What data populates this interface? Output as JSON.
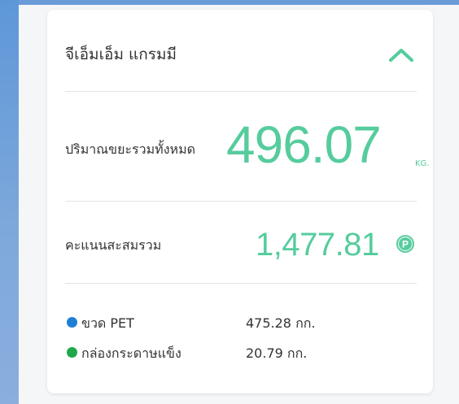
{
  "colors": {
    "accent": "#56cc9d",
    "pet_dot": "#1e7fd6",
    "paper_dot": "#1fa84a",
    "chevron": "#56cc9d"
  },
  "card": {
    "title": "จีเอ็มเอ็ม แกรมมี",
    "toggle_icon": "chevron-up-icon",
    "total": {
      "label": "ปริมาณขยะรวมทั้งหมด",
      "value": "496.07",
      "unit": "KG."
    },
    "points": {
      "label": "คะแนนสะสมรวม",
      "value": "1,477.81",
      "badge": "P"
    },
    "breakdown": [
      {
        "name": "ขวด PET",
        "amount": "475.28 กก.",
        "color": "#1e7fd6"
      },
      {
        "name": "กล่องกระดาษแข็ง",
        "amount": "20.79 กก.",
        "color": "#1fa84a"
      }
    ]
  }
}
